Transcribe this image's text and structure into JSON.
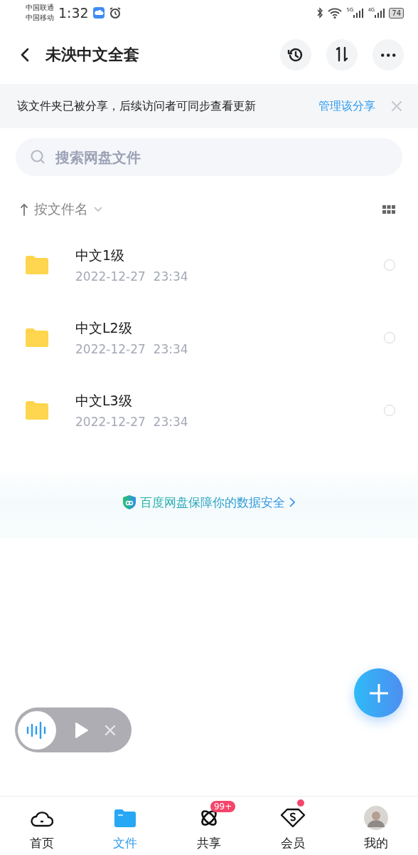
{
  "status_bar": {
    "carriers": [
      "中国联通",
      "中国移动"
    ],
    "time": "1:32",
    "network_1": "5G",
    "network_2": "4G",
    "battery": "74"
  },
  "header": {
    "title": "未泱中文全套"
  },
  "share_notice": {
    "text": "该文件夹已被分享，后续访问者可同步查看更新",
    "link": "管理该分享"
  },
  "search": {
    "placeholder": "搜索网盘文件"
  },
  "sort": {
    "label": "按文件名"
  },
  "files": [
    {
      "name": "中文1级",
      "modified": "2022-12-27  23:34",
      "selected": false
    },
    {
      "name": "中文L2级",
      "modified": "2022-12-27  23:34",
      "selected": false
    },
    {
      "name": "中文L3级",
      "modified": "2022-12-27  23:34",
      "selected": false
    }
  ],
  "security_note": "百度网盘保障你的数据安全",
  "tabs": [
    {
      "kind": "home",
      "label": "首页",
      "selected": false
    },
    {
      "kind": "files",
      "label": "文件",
      "selected": true
    },
    {
      "kind": "share",
      "label": "共享",
      "selected": false,
      "badge": "99+"
    },
    {
      "kind": "vip",
      "label": "会员",
      "selected": false,
      "dot": true
    },
    {
      "kind": "profile",
      "label": "我的",
      "selected": false
    }
  ]
}
